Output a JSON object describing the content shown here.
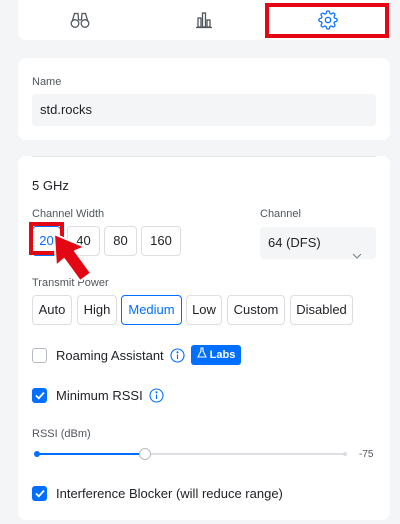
{
  "tabs": [
    {
      "name": "overview",
      "icon": "binoculars-icon"
    },
    {
      "name": "statistics",
      "icon": "bar-chart-icon"
    },
    {
      "name": "settings",
      "icon": "gear-icon",
      "active": true
    }
  ],
  "name_section": {
    "label": "Name",
    "value": "std.rocks"
  },
  "radio": {
    "band": "5 GHz",
    "channel_width": {
      "label": "Channel Width",
      "options": [
        "20",
        "40",
        "80",
        "160"
      ],
      "selected": "20"
    },
    "channel": {
      "label": "Channel",
      "value": "64 (DFS)"
    },
    "transmit_power": {
      "label": "Transmit Power",
      "options": [
        "Auto",
        "High",
        "Medium",
        "Low",
        "Custom",
        "Disabled"
      ],
      "selected": "Medium"
    },
    "roaming_assistant": {
      "label": "Roaming Assistant",
      "checked": false,
      "badge": "Labs"
    },
    "minimum_rssi": {
      "label": "Minimum RSSI",
      "checked": true
    },
    "rssi": {
      "label": "RSSI (dBm)",
      "value": "-75",
      "level": 0.35
    },
    "interference_blocker": {
      "label": "Interference Blocker (will reduce range)",
      "checked": true
    }
  },
  "colors": {
    "accent": "#006fff",
    "highlight": "#e30613",
    "background": "#f4f5f6"
  }
}
